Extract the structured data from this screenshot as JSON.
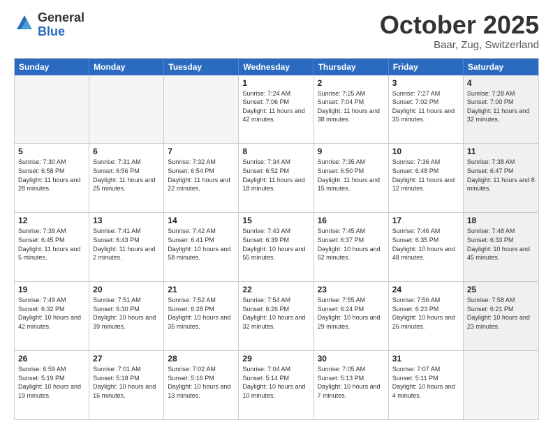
{
  "header": {
    "logo_general": "General",
    "logo_blue": "Blue",
    "month_title": "October 2025",
    "location": "Baar, Zug, Switzerland"
  },
  "weekdays": [
    "Sunday",
    "Monday",
    "Tuesday",
    "Wednesday",
    "Thursday",
    "Friday",
    "Saturday"
  ],
  "rows": [
    [
      {
        "day": "",
        "empty": true
      },
      {
        "day": "",
        "empty": true
      },
      {
        "day": "",
        "empty": true
      },
      {
        "day": "1",
        "sunrise": "7:24 AM",
        "sunset": "7:06 PM",
        "daylight": "11 hours and 42 minutes."
      },
      {
        "day": "2",
        "sunrise": "7:25 AM",
        "sunset": "7:04 PM",
        "daylight": "11 hours and 38 minutes."
      },
      {
        "day": "3",
        "sunrise": "7:27 AM",
        "sunset": "7:02 PM",
        "daylight": "11 hours and 35 minutes."
      },
      {
        "day": "4",
        "sunrise": "7:28 AM",
        "sunset": "7:00 PM",
        "daylight": "11 hours and 32 minutes.",
        "shaded": true
      }
    ],
    [
      {
        "day": "5",
        "sunrise": "7:30 AM",
        "sunset": "6:58 PM",
        "daylight": "11 hours and 28 minutes."
      },
      {
        "day": "6",
        "sunrise": "7:31 AM",
        "sunset": "6:56 PM",
        "daylight": "11 hours and 25 minutes."
      },
      {
        "day": "7",
        "sunrise": "7:32 AM",
        "sunset": "6:54 PM",
        "daylight": "11 hours and 22 minutes."
      },
      {
        "day": "8",
        "sunrise": "7:34 AM",
        "sunset": "6:52 PM",
        "daylight": "11 hours and 18 minutes."
      },
      {
        "day": "9",
        "sunrise": "7:35 AM",
        "sunset": "6:50 PM",
        "daylight": "11 hours and 15 minutes."
      },
      {
        "day": "10",
        "sunrise": "7:36 AM",
        "sunset": "6:48 PM",
        "daylight": "11 hours and 12 minutes."
      },
      {
        "day": "11",
        "sunrise": "7:38 AM",
        "sunset": "6:47 PM",
        "daylight": "11 hours and 8 minutes.",
        "shaded": true
      }
    ],
    [
      {
        "day": "12",
        "sunrise": "7:39 AM",
        "sunset": "6:45 PM",
        "daylight": "11 hours and 5 minutes."
      },
      {
        "day": "13",
        "sunrise": "7:41 AM",
        "sunset": "6:43 PM",
        "daylight": "11 hours and 2 minutes."
      },
      {
        "day": "14",
        "sunrise": "7:42 AM",
        "sunset": "6:41 PM",
        "daylight": "10 hours and 58 minutes."
      },
      {
        "day": "15",
        "sunrise": "7:43 AM",
        "sunset": "6:39 PM",
        "daylight": "10 hours and 55 minutes."
      },
      {
        "day": "16",
        "sunrise": "7:45 AM",
        "sunset": "6:37 PM",
        "daylight": "10 hours and 52 minutes."
      },
      {
        "day": "17",
        "sunrise": "7:46 AM",
        "sunset": "6:35 PM",
        "daylight": "10 hours and 48 minutes."
      },
      {
        "day": "18",
        "sunrise": "7:48 AM",
        "sunset": "6:33 PM",
        "daylight": "10 hours and 45 minutes.",
        "shaded": true
      }
    ],
    [
      {
        "day": "19",
        "sunrise": "7:49 AM",
        "sunset": "6:32 PM",
        "daylight": "10 hours and 42 minutes."
      },
      {
        "day": "20",
        "sunrise": "7:51 AM",
        "sunset": "6:30 PM",
        "daylight": "10 hours and 39 minutes."
      },
      {
        "day": "21",
        "sunrise": "7:52 AM",
        "sunset": "6:28 PM",
        "daylight": "10 hours and 35 minutes."
      },
      {
        "day": "22",
        "sunrise": "7:54 AM",
        "sunset": "6:26 PM",
        "daylight": "10 hours and 32 minutes."
      },
      {
        "day": "23",
        "sunrise": "7:55 AM",
        "sunset": "6:24 PM",
        "daylight": "10 hours and 29 minutes."
      },
      {
        "day": "24",
        "sunrise": "7:56 AM",
        "sunset": "6:23 PM",
        "daylight": "10 hours and 26 minutes."
      },
      {
        "day": "25",
        "sunrise": "7:58 AM",
        "sunset": "6:21 PM",
        "daylight": "10 hours and 23 minutes.",
        "shaded": true
      }
    ],
    [
      {
        "day": "26",
        "sunrise": "6:59 AM",
        "sunset": "5:19 PM",
        "daylight": "10 hours and 19 minutes."
      },
      {
        "day": "27",
        "sunrise": "7:01 AM",
        "sunset": "5:18 PM",
        "daylight": "10 hours and 16 minutes."
      },
      {
        "day": "28",
        "sunrise": "7:02 AM",
        "sunset": "5:16 PM",
        "daylight": "10 hours and 13 minutes."
      },
      {
        "day": "29",
        "sunrise": "7:04 AM",
        "sunset": "5:14 PM",
        "daylight": "10 hours and 10 minutes."
      },
      {
        "day": "30",
        "sunrise": "7:05 AM",
        "sunset": "5:13 PM",
        "daylight": "10 hours and 7 minutes."
      },
      {
        "day": "31",
        "sunrise": "7:07 AM",
        "sunset": "5:11 PM",
        "daylight": "10 hours and 4 minutes."
      },
      {
        "day": "",
        "empty": true,
        "shaded": true
      }
    ]
  ]
}
